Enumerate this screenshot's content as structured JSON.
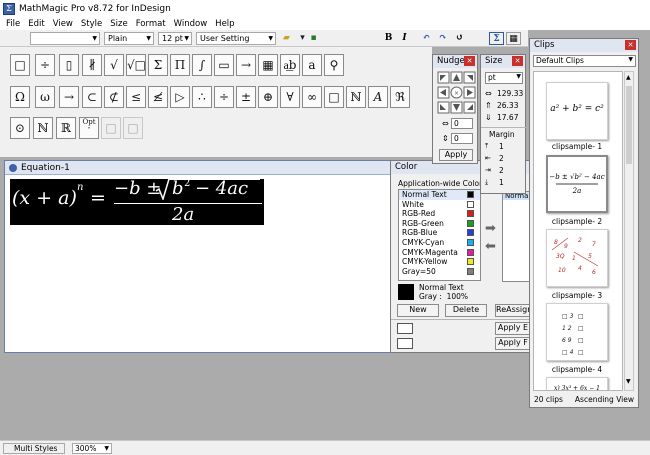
{
  "window": {
    "title": "MathMagic Pro v8.72 for InDesign"
  },
  "menu": [
    "File",
    "Edit",
    "View",
    "Style",
    "Size",
    "Format",
    "Window",
    "Help"
  ],
  "toolbar": {
    "style_value": "Plain",
    "size_value": "12 pt",
    "setting_value": "User Setting",
    "bold": "B",
    "italic": "I"
  },
  "palette": {
    "row1": [
      "□",
      "÷",
      "▯",
      "∦",
      "√",
      "√□",
      "Σ",
      "Π",
      "∫",
      "▭",
      "→",
      "▦",
      "a͟b",
      "a",
      "⚲"
    ],
    "row2": [
      "Ω",
      "ω",
      "→",
      "⊂",
      "⊄",
      "≤",
      "≰",
      "▷",
      "∴",
      "÷",
      "±",
      "⊕",
      "∀",
      "∞",
      "□",
      "ℕ",
      "A",
      "ℜ"
    ],
    "row3": [
      "⊙",
      "ℕ",
      "ℝ",
      "ˆ",
      "□",
      "□"
    ],
    "opt_label": "Opt"
  },
  "equation": {
    "title": "Equation-1",
    "lhs": "(x + a)",
    "exp_n": "n",
    "eq": "=",
    "num_pre": "−b ±",
    "radicand": "b",
    "exp_2": "2",
    "num_post": "− 4ac",
    "den": "2a"
  },
  "nudge": {
    "title": "Nudge",
    "h_value": "0",
    "v_value": "0",
    "apply": "Apply"
  },
  "size_panel": {
    "title": "Size",
    "unit": "pt",
    "values": [
      "129.33",
      "26.33",
      "17.67"
    ],
    "margin_label": "Margin",
    "margins": [
      "1",
      "2",
      "2",
      "1"
    ]
  },
  "color_panel": {
    "title": "Color",
    "header": "Application-wide Colors",
    "items": [
      {
        "name": "Normal Text",
        "color": "#000000"
      },
      {
        "name": "White",
        "color": "#ffffff"
      },
      {
        "name": "RGB-Red",
        "color": "#e01a1a"
      },
      {
        "name": "RGB-Green",
        "color": "#1aa01a"
      },
      {
        "name": "RGB-Blue",
        "color": "#2040e0"
      },
      {
        "name": "CMYK-Cyan",
        "color": "#18b0e8"
      },
      {
        "name": "CMYK-Magenta",
        "color": "#e020a0"
      },
      {
        "name": "CMYK-Yellow",
        "color": "#f0e818"
      },
      {
        "name": "Gray=50",
        "color": "#808080"
      }
    ],
    "preview_label": "Normal Text",
    "gray_label": "Gray :  100%",
    "new": "New",
    "delete": "Delete",
    "reassign": "ReAssign",
    "normal_tab": "Normal",
    "apply_e": "Apply E",
    "apply_f": "Apply F"
  },
  "clips": {
    "title": "Clips",
    "dropdown": "Default Clips",
    "items": [
      "clipsample- 1",
      "clipsample- 2",
      "clipsample- 3",
      "clipsample- 4"
    ],
    "clip1_text": "a² + b² = c²",
    "count": "20 clips",
    "view": "Ascending View"
  },
  "status": {
    "style": "Multi Styles",
    "zoom": "300%"
  }
}
